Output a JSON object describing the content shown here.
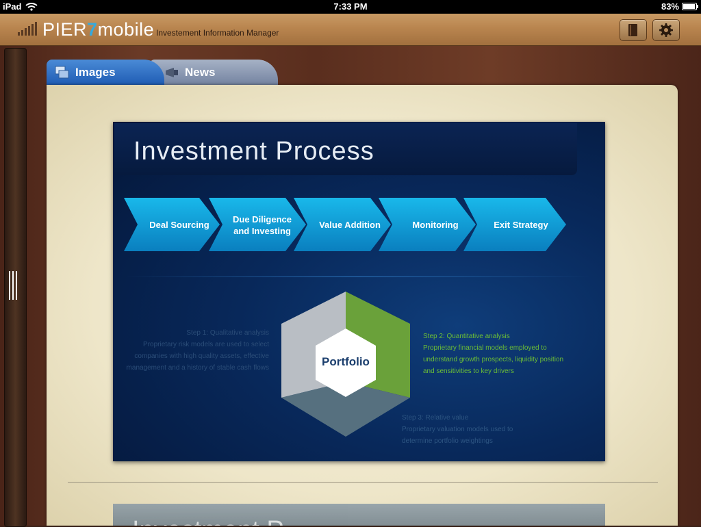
{
  "status_bar": {
    "device": "iPad",
    "time": "7:33 PM",
    "battery": "83%",
    "battery_level": 0.83
  },
  "header": {
    "logo_pier": "PIER",
    "logo_seven": "7",
    "logo_mobile": "mobile",
    "subtitle": "Investement Information Manager"
  },
  "tabs": [
    {
      "label": "Images",
      "selected": true
    },
    {
      "label": "News",
      "selected": false
    }
  ],
  "slide": {
    "title": "Investment Process",
    "process_steps": [
      "Deal Sourcing",
      "Due Diligence",
      "and Investing",
      "Value Addition",
      "Monitoring",
      "Exit Strategy"
    ],
    "center_label": "Portfolio",
    "step1": {
      "title": "Step 1: Qualitative analysis",
      "line1": "Proprietary risk models are used to select",
      "line2": "companies with high quality assets, effective",
      "line3": "management and a history of stable cash flows"
    },
    "step2": {
      "title": "Step 2: Quantitative analysis",
      "line1": "Proprietary financial models employed to",
      "line2": "understand growth prospects, liquidity position",
      "line3": "and sensitivities to key drivers"
    },
    "step3": {
      "title": "Step 3: Relative value",
      "line1": "Proprietary valuation models used to",
      "line2": "determine portfolio weightings"
    }
  },
  "next_slide": {
    "title": "Investment P"
  },
  "colors": {
    "accent_blue": "#36a9dc",
    "arrow_blue": "#12a7dd",
    "hex_green": "#6aa13a",
    "hex_gray": "#b9bec4",
    "hex_slate": "#56707f"
  }
}
